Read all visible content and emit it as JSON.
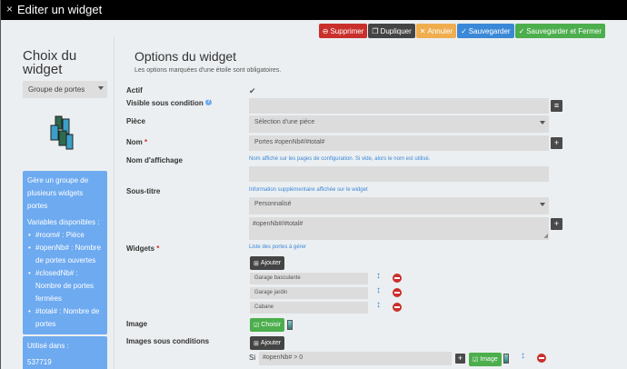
{
  "window": {
    "title": "Editer un widget",
    "close_icon": "×"
  },
  "toolbar": {
    "delete_label": "Supprimer",
    "duplicate_label": "Dupliquer",
    "cancel_label": "Annuler",
    "save_label": "Sauvegarder",
    "save_close_label": "Sauvegarder et Fermer",
    "colors": {
      "delete": "#c9302c",
      "duplicate": "#444444",
      "cancel": "#f0ad4e",
      "save": "#3b88d8",
      "save_close": "#4cae4c"
    }
  },
  "left": {
    "title": "Choix du widget",
    "type_select": "Groupe de portes",
    "description": "Gère un groupe de plusieurs widgets portes",
    "variables_title": "Variables disponibles :",
    "variables": [
      "#room# : Pièce",
      "#openNb# : Nombre de portes ouvertes",
      "#closedNb# : Nombre de portes fermées",
      "#total# : Nombre de portes"
    ],
    "used_in_title": "Utilisé dans :",
    "used_in_value": "537719"
  },
  "form": {
    "title": "Options du widget",
    "subtitle": "Les options marquées d'une étoile sont obligatoires.",
    "actif_label": "Actif",
    "visible_label": "Visible sous condition",
    "piece_label": "Pièce",
    "piece_value": "Sélection d'une pièce",
    "nom_label": "Nom",
    "nom_value": "Portes #openNb#/#total#",
    "affichage_label": "Nom d'affichage",
    "affichage_help": "Nom affiché sur les pages de configuration. Si vide, alors le nom est utilisé.",
    "soustitre_label": "Sous-titre",
    "soustitre_help": "Information supplémentaire affichée sur le widget",
    "soustitre_select": "Personnalisé",
    "soustitre_value": "#openNb#/#total#",
    "widgets_label": "Widgets",
    "widgets_help": "Liste des portes à gérer",
    "add_label": "Ajouter",
    "widgets": [
      "Garage basculante",
      "Garage jardin",
      "Cabane"
    ],
    "image_label": "Image",
    "choose_label": "Choisir",
    "images_cond_label": "Images sous conditions",
    "add_label2": "Ajouter",
    "si_label": "Si",
    "cond_value": "#openNb# > 0",
    "image_btn_label": "Image",
    "required_mark": "*"
  }
}
